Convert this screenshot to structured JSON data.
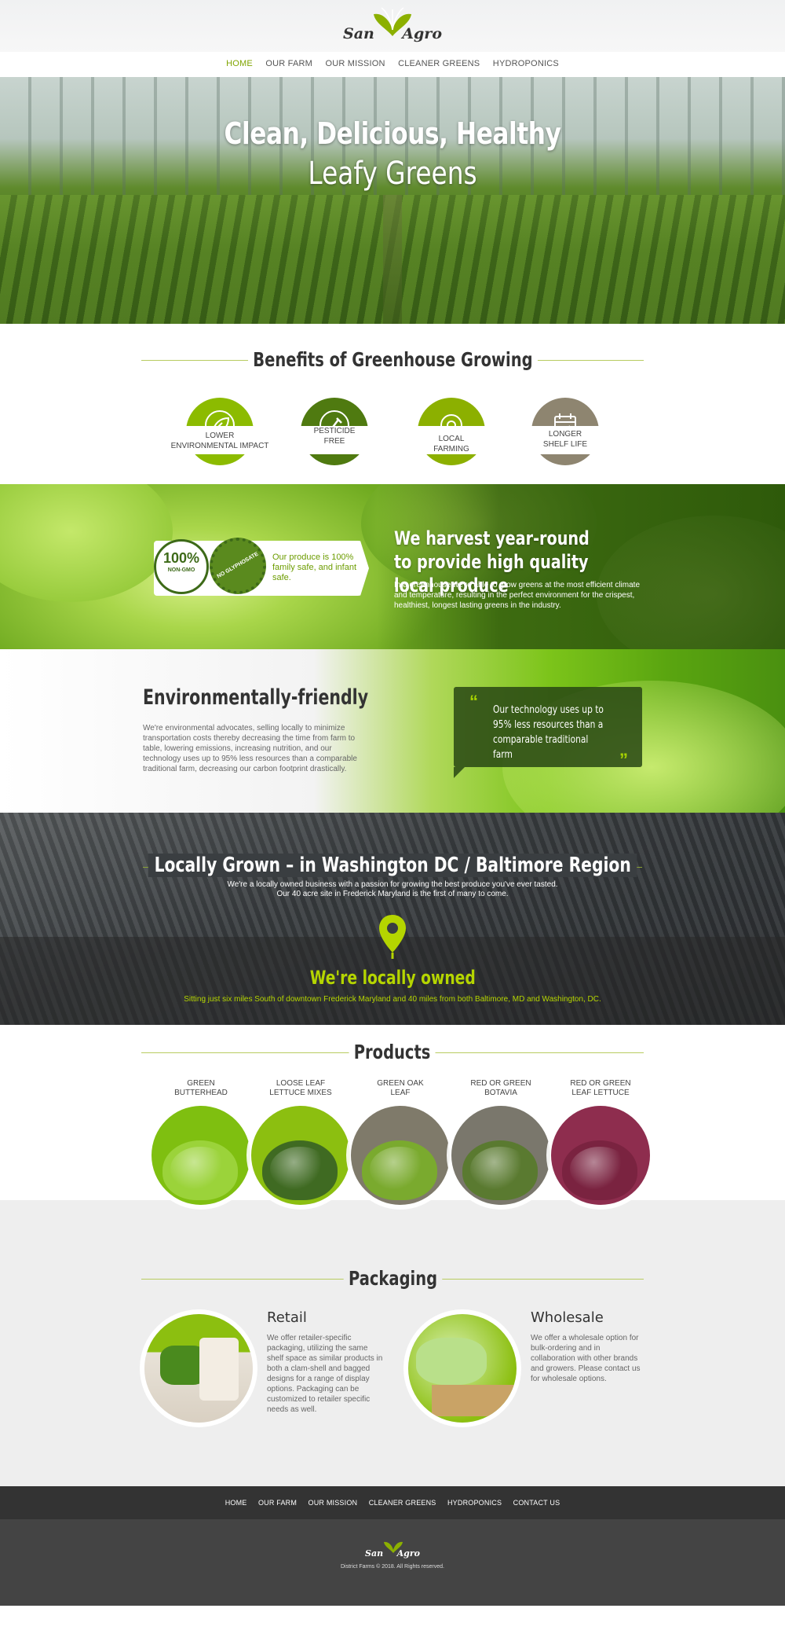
{
  "brand": {
    "name_left": "San",
    "name_right": "Agro",
    "accent": "#7fa400"
  },
  "nav": {
    "items": [
      {
        "label": "HOME",
        "active": true
      },
      {
        "label": "OUR FARM",
        "active": false
      },
      {
        "label": "OUR MISSION",
        "active": false
      },
      {
        "label": "CLEANER GREENS",
        "active": false
      },
      {
        "label": "HYDROPONICS",
        "active": false
      }
    ]
  },
  "hero": {
    "title_line1": "Clean, Delicious, Healthy",
    "title_line2": "Leafy Greens"
  },
  "benefits": {
    "title": "Benefits of Greenhouse Growing",
    "items": [
      {
        "line1": "LOWER",
        "line2": "ENVIRONMENTAL IMPACT",
        "icon": "leaf-icon",
        "color": "#8cbb00"
      },
      {
        "line1": "PESTICIDE",
        "line2": "FREE",
        "icon": "spray-icon",
        "color": "#4f7a10"
      },
      {
        "line1": "LOCAL",
        "line2": "FARMING",
        "icon": "location-icon",
        "color": "#8cb000"
      },
      {
        "line1": "LONGER",
        "line2": "SHELF LIFE",
        "icon": "calendar-icon",
        "color": "#8e8570"
      }
    ]
  },
  "harvest": {
    "badge_1_main": "100%",
    "badge_1_sub": "NON-GMO",
    "badge_2_text": "NO GLYPHOSATE",
    "badge_text": "Our produce is 100% family safe, and infant safe.",
    "title": "We harvest year-round to provide high quality local produce",
    "body": "In a greenhouse we're able to grow greens at the most efficient climate and temperature, resulting in the perfect environment for the crispest, healthiest, longest lasting greens in the industry."
  },
  "environment": {
    "title": "Environmentally-friendly",
    "body": "We're environmental advocates, selling locally to minimize transportation costs thereby decreasing the time from farm to table, lowering emissions, increasing nutrition, and our technology uses up to 95% less resources than a comparable traditional farm, decreasing our carbon footprint drastically.",
    "quote": "Our technology uses up to 95% less resources than a comparable traditional farm"
  },
  "local": {
    "title": "Locally Grown – in Washington DC / Baltimore Region",
    "body_line1": "We're a locally owned business with a passion for growing the best produce you've ever tasted.",
    "body_line2": "Our 40 acre site in Frederick Maryland is the first of many to come.",
    "owned_title": "We're locally owned",
    "owned_body": "Sitting just six miles South of downtown Frederick Maryland and 40 miles from both Baltimore, MD and Washington, DC."
  },
  "products": {
    "title": "Products",
    "items": [
      {
        "line1": "GREEN",
        "line2": "BUTTERHEAD",
        "circle": "#7fbf10",
        "veg": "#9bd33a"
      },
      {
        "line1": "LOOSE LEAF",
        "line2": "LETTUCE MIXES",
        "circle": "#8cbf10",
        "veg": "#3f6a22"
      },
      {
        "line1": "GREEN OAK",
        "line2": "LEAF",
        "circle": "#7f7a6a",
        "veg": "#7aaa2e"
      },
      {
        "line1": "RED OR GREEN",
        "line2": "BOTAVIA",
        "circle": "#7a776c",
        "veg": "#5a7a30"
      },
      {
        "line1": "RED OR GREEN",
        "line2": "LEAF LETTUCE",
        "circle": "#8e2d4e",
        "veg": "#7a2340"
      }
    ]
  },
  "packaging": {
    "title": "Packaging",
    "retail": {
      "title": "Retail",
      "body": "We offer retailer-specific packaging, utilizing the same shelf space as similar products in both a clam-shell and bagged designs for a range of display options. Packaging can be customized to retailer specific needs as well."
    },
    "wholesale": {
      "title": "Wholesale",
      "body": "We offer a wholesale option for bulk-ordering and in collaboration with other brands and growers. Please contact us for wholesale options."
    }
  },
  "footer": {
    "nav": [
      "HOME",
      "OUR FARM",
      "OUR MISSION",
      "CLEANER GREENS",
      "HYDROPONICS",
      "CONTACT US"
    ],
    "copyright": "District Farms © 2018. All Rights reserved."
  }
}
